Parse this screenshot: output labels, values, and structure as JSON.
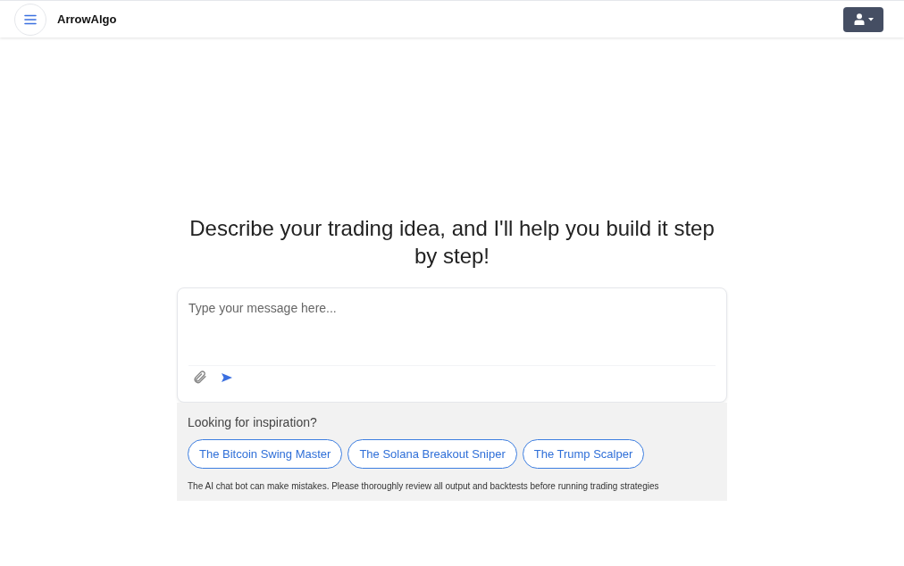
{
  "header": {
    "brand": "ArrowAlgo"
  },
  "heading": "Describe your trading idea, and I'll help you build it step by step!",
  "composer": {
    "placeholder": "Type your message here..."
  },
  "inspiration": {
    "title": "Looking for inspiration?",
    "suggestions": [
      "The Bitcoin Swing Master",
      "The Solana Breakout Sniper",
      "The Trump Scalper"
    ],
    "disclaimer": "The AI chat bot can make mistakes. Please thoroughly review all output and backtests before running trading strategies"
  }
}
